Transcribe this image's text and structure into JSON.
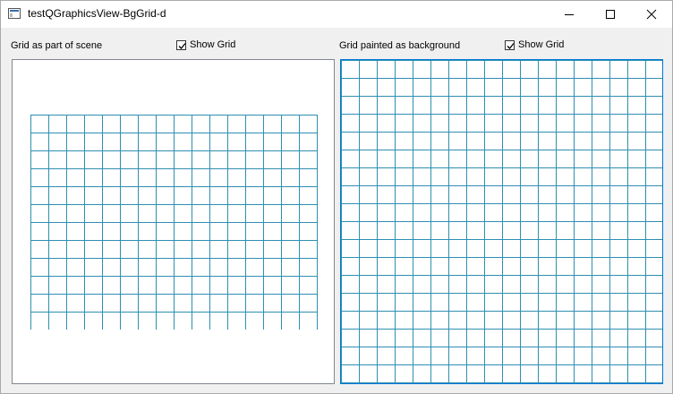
{
  "window": {
    "title": "testQGraphicsView-BgGrid-d",
    "icon": "app-window-icon",
    "controls": [
      "minimize-icon",
      "maximize-icon",
      "close-icon"
    ]
  },
  "left_panel": {
    "label": "Grid as part of scene",
    "checkbox": {
      "label": "Show Grid",
      "checked": true
    }
  },
  "right_panel": {
    "label": "Grid painted as background",
    "checkbox": {
      "label": "Show Grid",
      "checked": true
    }
  },
  "colors": {
    "grid": "#2e8fb0",
    "focus_border": "#0078d7"
  }
}
